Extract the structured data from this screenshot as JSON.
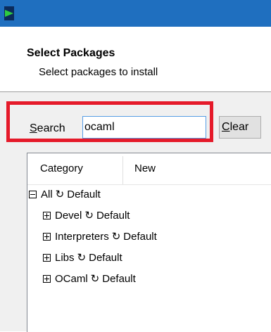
{
  "dialog": {
    "title": "Select Packages",
    "subtitle": "Select packages to install"
  },
  "search": {
    "label_underlined": "S",
    "label_rest": "earch",
    "value": "ocaml",
    "clear_underlined": "C",
    "clear_rest": "lear"
  },
  "columns": {
    "category": "Category",
    "new": "New"
  },
  "tree": {
    "root": {
      "name": "All",
      "state": "Default",
      "icon": "cycle-icon"
    },
    "children": [
      {
        "name": "Devel",
        "state": "Default"
      },
      {
        "name": "Interpreters",
        "state": "Default"
      },
      {
        "name": "Libs",
        "state": "Default"
      },
      {
        "name": "OCaml",
        "state": "Default"
      }
    ]
  },
  "colors": {
    "highlight": "#e51a2a",
    "titlebar": "#1f6fbf",
    "input_border": "#569de5"
  }
}
